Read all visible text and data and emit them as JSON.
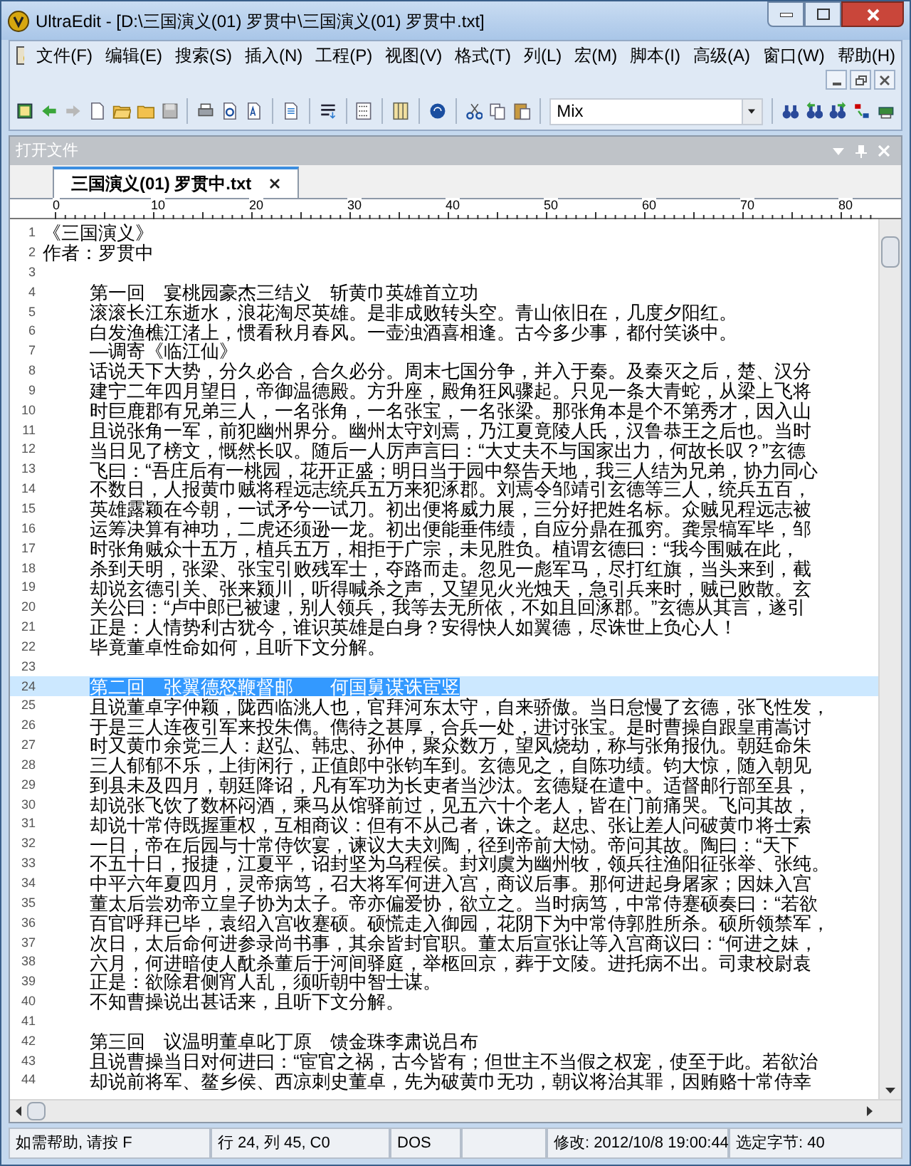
{
  "window": {
    "title": "UltraEdit - [D:\\三国演义(01) 罗贯中\\三国演义(01) 罗贯中.txt]"
  },
  "menu": [
    "文件(F)",
    "编辑(E)",
    "搜索(S)",
    "插入(N)",
    "工程(P)",
    "视图(V)",
    "格式(T)",
    "列(L)",
    "宏(M)",
    "脚本(I)",
    "高级(A)",
    "窗口(W)",
    "帮助(H)"
  ],
  "toolbar": {
    "dropdown_value": "Mix"
  },
  "panel": {
    "title": "打开文件"
  },
  "tabs": [
    {
      "label": "三国演义(01) 罗贯中.txt",
      "selected": true
    }
  ],
  "ruler": {
    "labels": [
      "0",
      "10",
      "20",
      "30",
      "40",
      "50",
      "60",
      "70",
      "80"
    ]
  },
  "lines": [
    {
      "number": "1",
      "text": "《三国演义》",
      "indent": false,
      "selected": false
    },
    {
      "number": "2",
      "text": "作者：罗贯中",
      "indent": false,
      "selected": false
    },
    {
      "number": "3",
      "selected": false
    },
    {
      "number": "4",
      "text": "第一回　宴桃园豪杰三结义　斩黄巾英雄首立功",
      "indent": true,
      "selected": false
    },
    {
      "number": "5",
      "text": "滚滚长江东逝水，浪花淘尽英雄。是非成败转头空。青山依旧在，几度夕阳红。",
      "indent": true,
      "selected": false
    },
    {
      "number": "6",
      "text": "白发渔樵江渚上，惯看秋月春风。一壶浊酒喜相逢。古今多少事，都付笑谈中。",
      "indent": true,
      "selected": false
    },
    {
      "number": "7",
      "text": "—调寄《临江仙》",
      "indent": true,
      "selected": false
    },
    {
      "number": "8",
      "text": "话说天下大势，分久必合，合久必分。周末七国分争，并入于秦。及秦灭之后，楚、汉分",
      "indent": true,
      "selected": false
    },
    {
      "number": "9",
      "text": "建宁二年四月望日，帝御温德殿。方升座，殿角狂风骤起。只见一条大青蛇，从梁上飞将",
      "indent": true,
      "selected": false
    },
    {
      "number": "10",
      "text": "时巨鹿郡有兄弟三人，一名张角，一名张宝，一名张梁。那张角本是个不第秀才，因入山",
      "indent": true,
      "selected": false
    },
    {
      "number": "11",
      "text": "且说张角一军，前犯幽州界分。幽州太守刘焉，乃江夏竟陵人氏，汉鲁恭王之后也。当时",
      "indent": true,
      "selected": false
    },
    {
      "number": "12",
      "text": "当日见了榜文，慨然长叹。随后一人厉声言曰：“大丈夫不与国家出力，何故长叹？”玄德",
      "indent": true,
      "selected": false
    },
    {
      "number": "13",
      "text": "飞曰：“吾庄后有一桃园，花开正盛；明日当于园中祭告天地，我三人结为兄弟，协力同心",
      "indent": true,
      "selected": false
    },
    {
      "number": "14",
      "text": "不数日，人报黄巾贼将程远志统兵五万来犯涿郡。刘焉令邹靖引玄德等三人，统兵五百，",
      "indent": true,
      "selected": false
    },
    {
      "number": "15",
      "text": "英雄露颖在今朝，一试矛兮一试刀。初出便将威力展，三分好把姓名标。众贼见程远志被",
      "indent": true,
      "selected": false
    },
    {
      "number": "16",
      "text": "运筹决算有神功，二虎还须逊一龙。初出便能垂伟绩，自应分鼎在孤穷。龚景犒军毕，邹",
      "indent": true,
      "selected": false
    },
    {
      "number": "17",
      "text": "时张角贼众十五万，植兵五万，相拒于广宗，未见胜负。植谓玄德曰：“我今围贼在此，",
      "indent": true,
      "selected": false
    },
    {
      "number": "18",
      "text": "杀到天明，张梁、张宝引败残军士，夺路而走。忽见一彪军马，尽打红旗，当头来到，截",
      "indent": true,
      "selected": false
    },
    {
      "number": "19",
      "text": "却说玄德引关、张来颍川，听得喊杀之声，又望见火光烛天，急引兵来时，贼已败散。玄",
      "indent": true,
      "selected": false
    },
    {
      "number": "20",
      "text": "关公曰：“卢中郎已被逮，别人领兵，我等去无所依，不如且回涿郡。”玄德从其言，遂引",
      "indent": true,
      "selected": false
    },
    {
      "number": "21",
      "text": "正是：人情势利古犹今，谁识英雄是白身？安得快人如翼德，尽诛世上负心人！",
      "indent": true,
      "selected": false
    },
    {
      "number": "22",
      "text": "毕竟董卓性命如何，且听下文分解。",
      "indent": true,
      "selected": false
    },
    {
      "number": "23",
      "selected": false
    },
    {
      "number": "24",
      "text": "第二回　张翼德怒鞭督邮　　何国舅谋诛宦竖",
      "indent": true,
      "selected": true
    },
    {
      "number": "25",
      "text": "且说董卓字仲颖，陇西临洮人也，官拜河东太守，自来骄傲。当日怠慢了玄德，张飞性发，",
      "indent": true,
      "selected": false
    },
    {
      "number": "26",
      "text": "于是三人连夜引军来投朱儁。儁待之甚厚，合兵一处，进讨张宝。是时曹操自跟皇甫嵩讨",
      "indent": true,
      "selected": false
    },
    {
      "number": "27",
      "text": "时又黄巾余党三人：赵弘、韩忠、孙仲，聚众数万，望风烧劫，称与张角报仇。朝廷命朱",
      "indent": true,
      "selected": false
    },
    {
      "number": "28",
      "text": "三人郁郁不乐，上街闲行，正值郎中张钧车到。玄德见之，自陈功绩。钧大惊，随入朝见",
      "indent": true,
      "selected": false
    },
    {
      "number": "29",
      "text": "到县未及四月，朝廷降诏，凡有军功为长吏者当沙汰。玄德疑在遣中。适督邮行部至县，",
      "indent": true,
      "selected": false
    },
    {
      "number": "30",
      "text": "却说张飞饮了数杯闷酒，乘马从馆驿前过，见五六十个老人，皆在门前痛哭。飞问其故，",
      "indent": true,
      "selected": false
    },
    {
      "number": "31",
      "text": "却说十常侍既握重权，互相商议：但有不从己者，诛之。赵忠、张让差人问破黄巾将士索",
      "indent": true,
      "selected": false
    },
    {
      "number": "32",
      "text": "一日，帝在后园与十常侍饮宴，谏议大夫刘陶，径到帝前大恸。帝问其故。陶曰：“天下",
      "indent": true,
      "selected": false
    },
    {
      "number": "33",
      "text": "不五十日，报捷，江夏平，诏封坚为乌程侯。封刘虞为幽州牧，领兵往渔阳征张举、张纯。",
      "indent": true,
      "selected": false
    },
    {
      "number": "34",
      "text": "中平六年夏四月，灵帝病笃，召大将军何进入宫，商议后事。那何进起身屠家；因妹入宫",
      "indent": true,
      "selected": false
    },
    {
      "number": "35",
      "text": "董太后尝劝帝立皇子协为太子。帝亦偏爱协，欲立之。当时病笃，中常侍蹇硕奏曰：“若欲",
      "indent": true,
      "selected": false
    },
    {
      "number": "36",
      "text": "百官呼拜已毕，袁绍入宫收蹇硕。硕慌走入御园，花阴下为中常侍郭胜所杀。硕所领禁军，",
      "indent": true,
      "selected": false
    },
    {
      "number": "37",
      "text": "次日，太后命何进参录尚书事，其余皆封官职。董太后宣张让等入宫商议曰：“何进之妹，",
      "indent": true,
      "selected": false
    },
    {
      "number": "38",
      "text": "六月，何进暗使人酖杀董后于河间驿庭，举柩回京，葬于文陵。进托病不出。司隶校尉袁",
      "indent": true,
      "selected": false
    },
    {
      "number": "39",
      "text": "正是：欲除君侧宵人乱，须听朝中智士谋。",
      "indent": true,
      "selected": false
    },
    {
      "number": "40",
      "text": "不知曹操说出甚话来，且听下文分解。",
      "indent": true,
      "selected": false
    },
    {
      "number": "41",
      "selected": false
    },
    {
      "number": "42",
      "text": "第三回　议温明董卓叱丁原　馈金珠李肃说吕布",
      "indent": true,
      "selected": false
    },
    {
      "number": "43",
      "text": "且说曹操当日对何进曰：“宦官之祸，古今皆有；但世主不当假之权宠，使至于此。若欲治",
      "indent": true,
      "selected": false
    },
    {
      "number": "44",
      "text": "却说前将军、鳌乡侯、西凉刺史董卓，先为破黄巾无功，朝议将治其罪，因贿赂十常侍幸",
      "indent": true,
      "selected": false
    }
  ],
  "status_bar": {
    "help": "如需帮助, 请按 F",
    "position": "行 24, 列 45, C0",
    "format": "DOS",
    "modified": "修改: 2012/10/8 19:00:44",
    "selection": "选定字节: 40"
  }
}
